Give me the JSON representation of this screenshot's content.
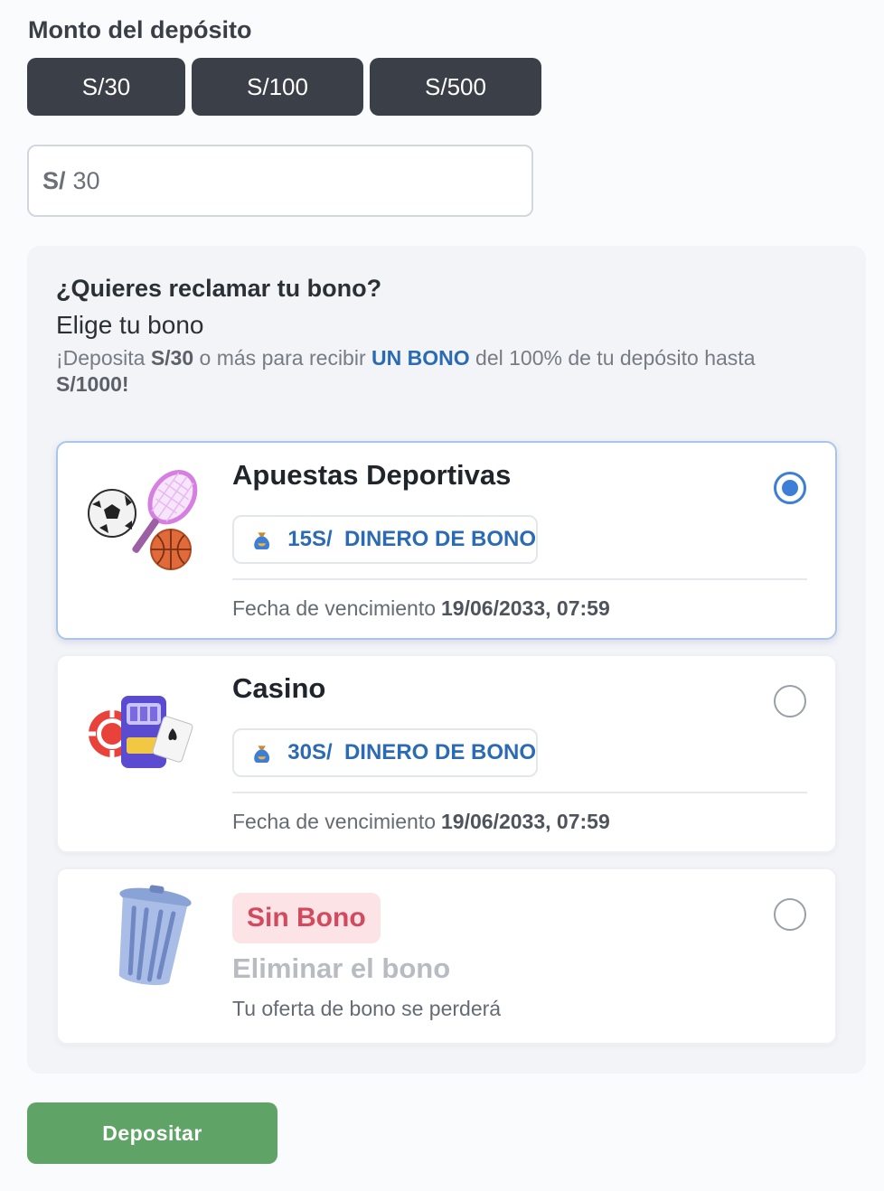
{
  "deposit": {
    "title": "Monto del depósito",
    "presets": [
      "S/30",
      "S/100",
      "S/500"
    ],
    "currency_prefix": "S/",
    "amount_value": "30"
  },
  "bonus": {
    "question": "¿Quieres reclamar tu bono?",
    "subtitle": "Elige tu bono",
    "promo": {
      "p1": "¡Deposita ",
      "min": "S/30",
      "p2": " o más para recibir ",
      "highlight": "UN BONO",
      "p3": " del 100% de tu depósito hasta ",
      "max": "S/1000!"
    },
    "options": [
      {
        "title": "Apuestas Deportivas",
        "bonus_text": "15S/  DINERO DE BONO",
        "expiry_label": "Fecha de vencimiento",
        "expiry_value": "19/06/2033, 07:59",
        "selected": true,
        "icon": "sports-balls-icon"
      },
      {
        "title": "Casino",
        "bonus_text": "30S/  DINERO DE BONO",
        "expiry_label": "Fecha de vencimiento",
        "expiry_value": "19/06/2033, 07:59",
        "selected": false,
        "icon": "slot-machine-icon"
      }
    ],
    "no_bonus": {
      "badge": "Sin Bono",
      "title": "Eliminar el bono",
      "note": "Tu oferta de bono se perderá",
      "selected": false,
      "icon": "trash-can-icon"
    }
  },
  "submit_label": "Depositar",
  "colors": {
    "chip_bg": "#3b4048",
    "accent_blue": "#2b6bb3",
    "radio_selected": "#3d7fd6",
    "submit_green": "#5fa466",
    "no_bonus_red": "#d24a5d"
  }
}
